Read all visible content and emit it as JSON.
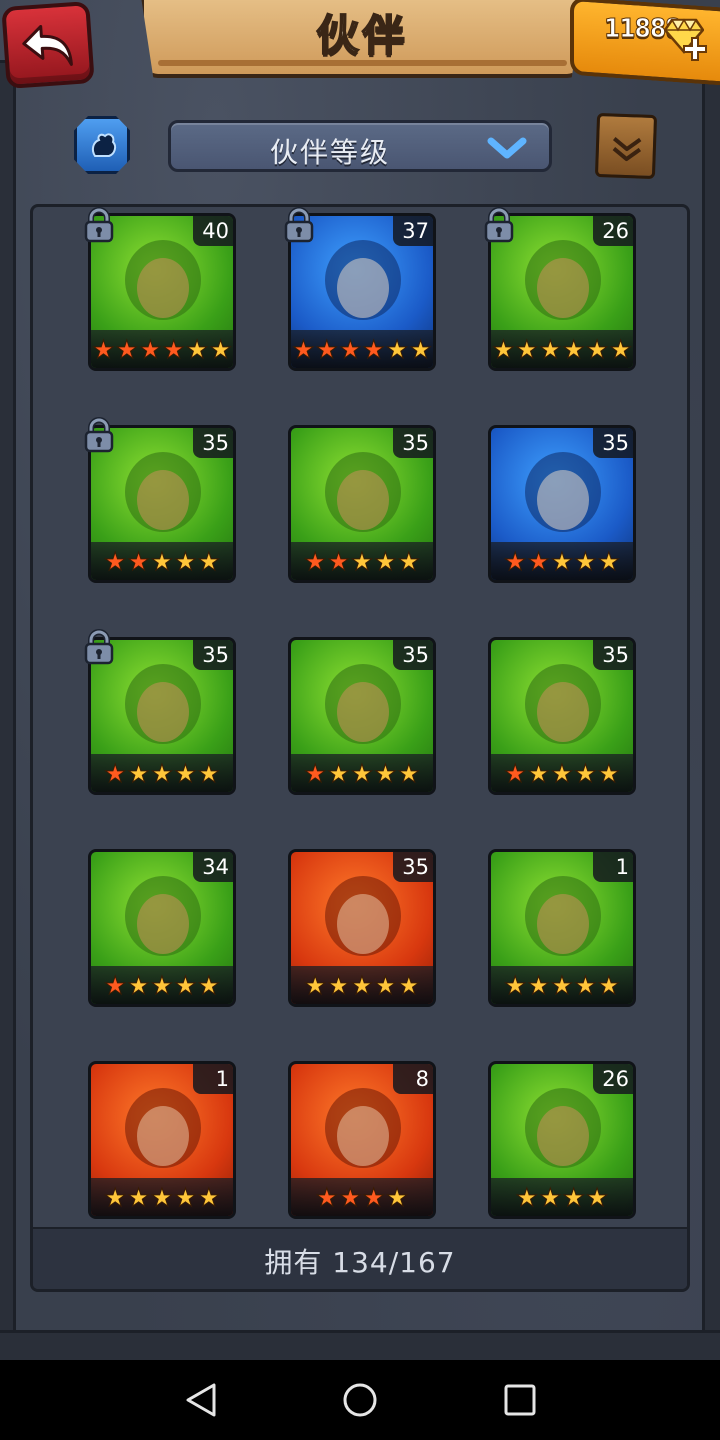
{
  "header": {
    "title": "伙伴",
    "gems": "11888"
  },
  "filter": {
    "sort_label": "伙伴等级"
  },
  "partners": [
    {
      "level": "40",
      "bg": "green",
      "locked": true,
      "stars": [
        "red",
        "red",
        "red",
        "red",
        "gold",
        "gold"
      ]
    },
    {
      "level": "37",
      "bg": "blue",
      "locked": true,
      "stars": [
        "red",
        "red",
        "red",
        "red",
        "gold",
        "gold"
      ]
    },
    {
      "level": "26",
      "bg": "green",
      "locked": true,
      "stars": [
        "gold",
        "gold",
        "gold",
        "gold",
        "gold",
        "gold"
      ]
    },
    {
      "level": "35",
      "bg": "green",
      "locked": true,
      "stars": [
        "red",
        "red",
        "gold",
        "gold",
        "gold"
      ]
    },
    {
      "level": "35",
      "bg": "green",
      "locked": false,
      "stars": [
        "red",
        "red",
        "gold",
        "gold",
        "gold"
      ]
    },
    {
      "level": "35",
      "bg": "blue",
      "locked": false,
      "stars": [
        "red",
        "red",
        "gold",
        "gold",
        "gold"
      ]
    },
    {
      "level": "35",
      "bg": "green",
      "locked": true,
      "stars": [
        "red",
        "gold",
        "gold",
        "gold",
        "gold"
      ]
    },
    {
      "level": "35",
      "bg": "green",
      "locked": false,
      "stars": [
        "red",
        "gold",
        "gold",
        "gold",
        "gold"
      ]
    },
    {
      "level": "35",
      "bg": "green",
      "locked": false,
      "stars": [
        "red",
        "gold",
        "gold",
        "gold",
        "gold"
      ]
    },
    {
      "level": "34",
      "bg": "green",
      "locked": false,
      "stars": [
        "red",
        "gold",
        "gold",
        "gold",
        "gold"
      ]
    },
    {
      "level": "35",
      "bg": "red",
      "locked": false,
      "stars": [
        "gold",
        "gold",
        "gold",
        "gold",
        "gold"
      ]
    },
    {
      "level": "1",
      "bg": "green",
      "locked": false,
      "stars": [
        "gold",
        "gold",
        "gold",
        "gold",
        "gold"
      ]
    },
    {
      "level": "1",
      "bg": "red",
      "locked": false,
      "stars": [
        "gold",
        "gold",
        "gold",
        "gold",
        "gold"
      ]
    },
    {
      "level": "8",
      "bg": "red",
      "locked": false,
      "stars": [
        "red",
        "red",
        "red",
        "gold"
      ]
    },
    {
      "level": "26",
      "bg": "green",
      "locked": false,
      "stars": [
        "gold",
        "gold",
        "gold",
        "gold"
      ]
    }
  ],
  "footer": {
    "owned_text": "拥有 134/167"
  },
  "colors": {
    "star_gold": "#ffc63a",
    "star_red": "#ff5a1f",
    "card_green": "#3aa018",
    "card_red": "#d8380f",
    "card_blue": "#1b5bc8",
    "back_button": "#c22830",
    "gem_panel": "#f5a01e"
  },
  "icons": {
    "back": "curved-back-arrow-icon",
    "gem": "diamond-gem-icon",
    "add": "plus-icon",
    "sort_toggle": "element-filter-icon",
    "dropdown": "chevron-down-icon",
    "codex": "scroll-book-icon",
    "lock": "padlock-icon"
  }
}
